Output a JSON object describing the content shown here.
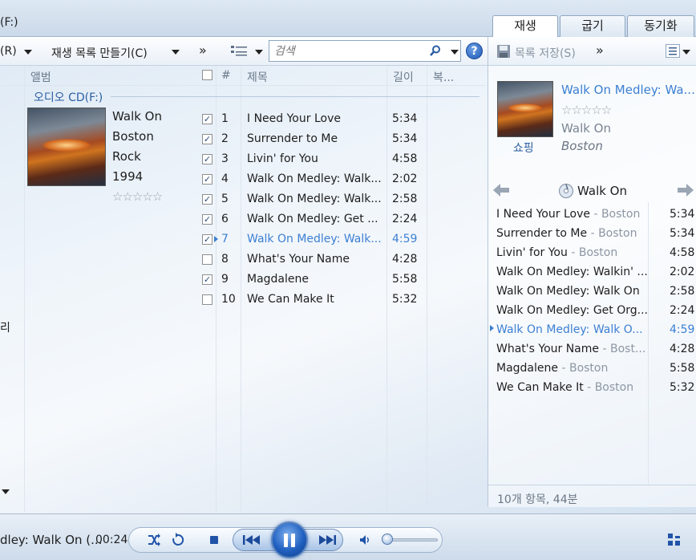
{
  "window": {
    "location_label": "(F:)",
    "view_tabs": [
      "재생",
      "굽기",
      "동기화"
    ]
  },
  "toolbar": {
    "organize_label": "(R)",
    "create_playlist_label": "재생 목록 만들기(C)",
    "more_chevron": "»",
    "search_placeholder": "검색",
    "help_glyph": "?"
  },
  "library": {
    "columns": [
      "앨범",
      "#",
      "제목",
      "길이",
      "복..."
    ],
    "group_header": "오디오 CD(F:)",
    "left_nav_fragment": "리",
    "album": {
      "title": "Walk On",
      "artist": "Boston",
      "genre": "Rock",
      "year": "1994",
      "rating_stars": "☆☆☆☆☆",
      "rating": 0
    },
    "tracks": [
      {
        "num": "1",
        "title": "I Need Your Love",
        "length": "5:34",
        "checked": true,
        "playing": false
      },
      {
        "num": "2",
        "title": "Surrender to Me",
        "length": "5:34",
        "checked": true,
        "playing": false
      },
      {
        "num": "3",
        "title": "Livin' for You",
        "length": "4:58",
        "checked": true,
        "playing": false
      },
      {
        "num": "4",
        "title": "Walk On Medley: Walk...",
        "length": "2:02",
        "checked": true,
        "playing": false
      },
      {
        "num": "5",
        "title": "Walk On Medley: Walk...",
        "length": "2:58",
        "checked": true,
        "playing": false
      },
      {
        "num": "6",
        "title": "Walk On Medley: Get ...",
        "length": "2:24",
        "checked": true,
        "playing": false
      },
      {
        "num": "7",
        "title": "Walk On Medley: Walk...",
        "length": "4:59",
        "checked": true,
        "playing": true
      },
      {
        "num": "8",
        "title": "What's Your Name",
        "length": "4:28",
        "checked": false,
        "playing": false
      },
      {
        "num": "9",
        "title": "Magdalene",
        "length": "5:58",
        "checked": true,
        "playing": false
      },
      {
        "num": "10",
        "title": "We Can Make It",
        "length": "5:32",
        "checked": false,
        "playing": false
      }
    ]
  },
  "now_playing_panel": {
    "save_list_label": "목록 저장(S)",
    "more_chevron": "»",
    "track_title": "Walk On Medley: Wa...",
    "rating_stars": "☆☆☆☆☆",
    "album": "Walk On",
    "artist": "Boston",
    "shopping_label": "쇼핑",
    "nav_album_label": "Walk On",
    "footer_summary": "10개 항목, 44분",
    "playlist": [
      {
        "title": "I Need Your Love",
        "artist": "Boston",
        "length": "5:34",
        "playing": false
      },
      {
        "title": "Surrender to Me",
        "artist": "Boston",
        "length": "5:34",
        "playing": false
      },
      {
        "title": "Livin' for You",
        "artist": "Boston",
        "length": "4:58",
        "playing": false
      },
      {
        "title": "Walk On Medley: Walkin' ...",
        "artist": "",
        "length": "2:02",
        "playing": false
      },
      {
        "title": "Walk On Medley: Walk On",
        "artist": "",
        "length": "2:58",
        "playing": false
      },
      {
        "title": "Walk On Medley: Get Org...",
        "artist": "",
        "length": "2:24",
        "playing": false
      },
      {
        "title": "Walk On Medley: Walk O...",
        "artist": "",
        "length": "4:59",
        "playing": true
      },
      {
        "title": "What's Your Name",
        "artist": "Bost...",
        "length": "4:28",
        "playing": false
      },
      {
        "title": "Magdalene",
        "artist": "Boston",
        "length": "5:58",
        "playing": false
      },
      {
        "title": "We Can Make It",
        "artist": "Boston",
        "length": "5:32",
        "playing": false
      }
    ]
  },
  "player": {
    "now_playing_text": "dley: Walk On (...",
    "elapsed": "00:24",
    "volume_level": 0.1,
    "icons": [
      "shuffle-icon",
      "repeat-icon",
      "stop-icon",
      "previous-icon",
      "pause-icon",
      "next-icon",
      "volume-icon",
      "switch-to-now-playing-icon"
    ]
  },
  "colors": {
    "accent_blue": "#3c7fd3",
    "play_button": "#2060c0",
    "text": "#1e1e1e",
    "muted": "#8c96a3"
  }
}
